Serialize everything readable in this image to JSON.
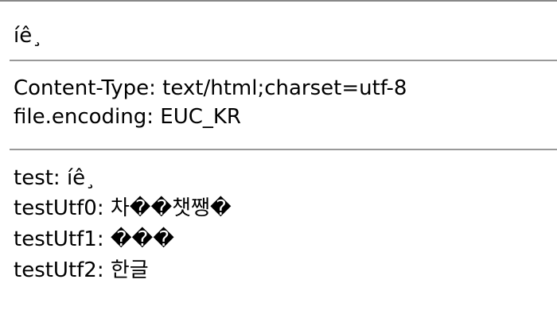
{
  "heading": "íê¸",
  "headers": {
    "content_type": "Content-Type: text/html;charset=utf-8",
    "file_encoding": "file.encoding: EUC_KR"
  },
  "tests": [
    "test: íê¸",
    "testUtf0: 차��챗쨍�",
    "testUtf1: ���",
    "testUtf2: 한글"
  ]
}
